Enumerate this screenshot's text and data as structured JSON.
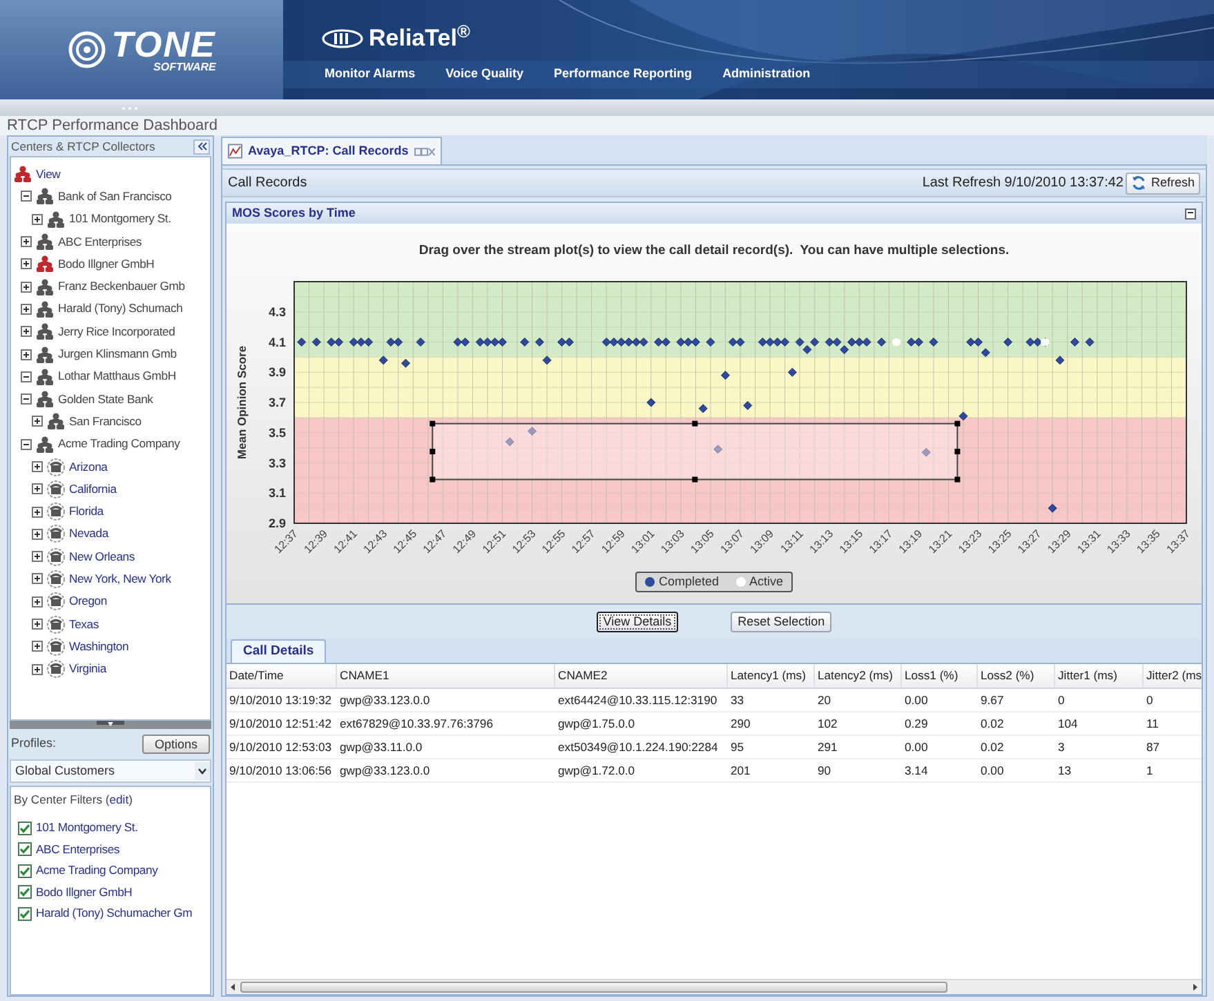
{
  "header": {
    "logo": {
      "name": "TONE",
      "tagline": "SOFTWARE"
    },
    "product": "ReliaTel$^{®}$",
    "nav": [
      {
        "label": "Monitor Alarms"
      },
      {
        "label": "Voice Quality"
      },
      {
        "label": "Performance Reporting"
      },
      {
        "label": "Administration"
      }
    ]
  },
  "page_title": "RTCP Performance Dashboard",
  "sidebar": {
    "title": "Centers & RTCP Collectors",
    "tree": [
      {
        "label": "View",
        "kind": "root",
        "alarm": true,
        "children": [
          {
            "label": "Bank of San Francisco",
            "kind": "center",
            "alarm": false,
            "expanded": true,
            "children": [
              {
                "label": "101 Montgomery St.",
                "kind": "center",
                "alarm": false,
                "expanded": false
              }
            ]
          },
          {
            "label": "ABC Enterprises",
            "kind": "center",
            "alarm": false,
            "expanded": false
          },
          {
            "label": "Bodo Illgner GmbH",
            "kind": "center",
            "alarm": true,
            "expanded": false
          },
          {
            "label": "Franz Beckenbauer Gmb",
            "kind": "center",
            "alarm": false,
            "expanded": false
          },
          {
            "label": "Harald (Tony) Schumach",
            "kind": "center",
            "alarm": false,
            "expanded": false
          },
          {
            "label": "Jerry Rice Incorporated",
            "kind": "center",
            "alarm": false,
            "expanded": false
          },
          {
            "label": "Jurgen Klinsmann Gmb",
            "kind": "center",
            "alarm": false,
            "expanded": false
          },
          {
            "label": "Lothar Matthaus GmbH",
            "kind": "center",
            "alarm": false,
            "expanded": true
          },
          {
            "label": "Golden State Bank",
            "kind": "center",
            "alarm": false,
            "expanded": true,
            "children": [
              {
                "label": "San Francisco",
                "kind": "center",
                "alarm": false,
                "expanded": false
              }
            ]
          },
          {
            "label": "Acme Trading Company",
            "kind": "center",
            "alarm": false,
            "expanded": true,
            "children": [
              {
                "label": "Arizona",
                "kind": "collector",
                "alarm": false,
                "expanded": false
              },
              {
                "label": "California",
                "kind": "collector",
                "alarm": false,
                "expanded": false
              },
              {
                "label": "Florida",
                "kind": "collector",
                "alarm": false,
                "expanded": false
              },
              {
                "label": "Nevada",
                "kind": "collector",
                "alarm": false,
                "expanded": false
              },
              {
                "label": "New Orleans",
                "kind": "collector",
                "alarm": false,
                "expanded": false
              },
              {
                "label": "New York, New York",
                "kind": "collector",
                "alarm": false,
                "expanded": false
              },
              {
                "label": "Oregon",
                "kind": "collector",
                "alarm": false,
                "expanded": false
              },
              {
                "label": "Texas",
                "kind": "collector",
                "alarm": false,
                "expanded": false
              },
              {
                "label": "Washington",
                "kind": "collector",
                "alarm": false,
                "expanded": false
              },
              {
                "label": "Virginia",
                "kind": "collector",
                "alarm": false,
                "expanded": false
              }
            ]
          }
        ]
      }
    ],
    "profiles_label": "Profiles:",
    "options_button": "Options",
    "profile_select": {
      "value": "Global Customers"
    },
    "filters_prefix": "By Center Filters (",
    "filters_link": "edit",
    "filters_suffix": ")",
    "filters": [
      {
        "label": "101 Montgomery St.",
        "checked": true
      },
      {
        "label": "ABC Enterprises",
        "checked": true
      },
      {
        "label": "Acme Trading Company",
        "checked": true
      },
      {
        "label": "Bodo Illgner GmbH",
        "checked": true
      },
      {
        "label": "Harald (Tony) Schumacher Gm",
        "checked": true
      }
    ]
  },
  "tab": {
    "label": "Avaya_RTCP: Call Records",
    "selected": true
  },
  "records": {
    "title": "Call Records",
    "last_refresh": "Last Refresh 9/10/2010 13:37:42",
    "refresh_button": "Refresh"
  },
  "mos": {
    "title": "MOS Scores by Time",
    "instruction": "Drag over the stream plot(s) to view the call detail record(s).  You can have multiple selections.",
    "chart_data": {
      "type": "scatter",
      "ylabel": "Mean Opinion Score",
      "ylim": [
        2.9,
        4.5
      ],
      "grid": true,
      "yticks": [
        2.9,
        3.1,
        3.3,
        3.5,
        3.7,
        3.9,
        4.1,
        4.3
      ],
      "series": [
        {
          "name": "Completed",
          "color": "#2f4a9c",
          "values": [
            null,
            4.1,
            null,
            4.1,
            null,
            4.1,
            4.1,
            null,
            4.1,
            4.1,
            4.1,
            null,
            3.98,
            4.1,
            4.1,
            3.96,
            null,
            4.1,
            null,
            null,
            null,
            null,
            4.1,
            4.1,
            null,
            4.1,
            4.1,
            4.1,
            4.1,
            3.44,
            null,
            4.1,
            3.51,
            4.1,
            3.98,
            null,
            4.1,
            4.1,
            null,
            null,
            null,
            null,
            4.1,
            4.1,
            4.1,
            4.1,
            4.1,
            4.1,
            3.7,
            4.1,
            4.1,
            null,
            4.1,
            4.1,
            4.1,
            3.66,
            4.1,
            3.39,
            3.88,
            4.1,
            4.1,
            3.68,
            null,
            4.1,
            4.1,
            4.1,
            4.1,
            3.9,
            4.1,
            4.05,
            4.1,
            null,
            4.1,
            4.1,
            4.05,
            4.1,
            4.1,
            4.1,
            null,
            4.1,
            null,
            null,
            null,
            4.1,
            4.1,
            3.37,
            4.1,
            null,
            null,
            null,
            3.61,
            4.1,
            4.1,
            4.03,
            null,
            null,
            4.1,
            null,
            null,
            4.1,
            4.1,
            4.1,
            3.0,
            3.98,
            null,
            4.1,
            null,
            4.1,
            null,
            null,
            null,
            null,
            null,
            null,
            null,
            null,
            null,
            null,
            null,
            null,
            null
          ]
        },
        {
          "name": "Active",
          "color": "#ffffff",
          "values": [
            null,
            null,
            null,
            null,
            null,
            null,
            null,
            null,
            null,
            null,
            null,
            null,
            null,
            null,
            null,
            null,
            null,
            null,
            null,
            null,
            null,
            null,
            null,
            null,
            null,
            null,
            null,
            null,
            null,
            null,
            null,
            null,
            null,
            null,
            null,
            null,
            null,
            null,
            null,
            null,
            null,
            null,
            null,
            null,
            null,
            null,
            null,
            null,
            null,
            null,
            null,
            null,
            null,
            null,
            null,
            null,
            null,
            null,
            null,
            null,
            null,
            null,
            null,
            null,
            null,
            null,
            null,
            null,
            null,
            null,
            null,
            null,
            null,
            null,
            null,
            null,
            null,
            null,
            null,
            null,
            null,
            4.1,
            null,
            null,
            null,
            null,
            null,
            null,
            null,
            null,
            null,
            null,
            null,
            null,
            null,
            null,
            null,
            null,
            null,
            null,
            null,
            4.1,
            null,
            null,
            null,
            null,
            null,
            null,
            null,
            null,
            null,
            null,
            null,
            null,
            null,
            null,
            null,
            null,
            null,
            null,
            null
          ]
        }
      ],
      "categories": [
        "12:37",
        null,
        null,
        null,
        "12:39",
        null,
        null,
        null,
        "12:41",
        null,
        null,
        null,
        "12:43",
        null,
        null,
        null,
        "12:45",
        null,
        null,
        null,
        "12:47",
        null,
        null,
        null,
        "12:49",
        null,
        null,
        null,
        "12:51",
        null,
        null,
        null,
        "12:53",
        null,
        null,
        null,
        "12:55",
        null,
        null,
        null,
        "12:57",
        null,
        null,
        null,
        "12:59",
        null,
        null,
        null,
        "13:01",
        null,
        null,
        null,
        "13:03",
        null,
        null,
        null,
        "13:05",
        null,
        null,
        null,
        "13:07",
        null,
        null,
        null,
        "13:09",
        null,
        null,
        null,
        "13:11",
        null,
        null,
        null,
        "13:13",
        null,
        null,
        null,
        "13:15",
        null,
        null,
        null,
        "13:17",
        null,
        null,
        null,
        "13:19",
        null,
        null,
        null,
        "13:21",
        null,
        null,
        null,
        "13:23",
        null,
        null,
        null,
        "13:25",
        null,
        null,
        null,
        "13:27",
        null,
        null,
        null,
        "13:29",
        null,
        null,
        null,
        "13:31",
        null,
        null,
        null,
        "13:33",
        null,
        null,
        null,
        "13:35",
        null,
        null,
        null,
        "13:37"
      ]
    },
    "selection_active": true
  },
  "actions": [
    {
      "label": "View Details",
      "focused": true
    },
    {
      "label": "Reset Selection",
      "focused": false
    }
  ],
  "details_tab": {
    "label": "Call Details",
    "selected": true
  },
  "table": {
    "columns": [
      "Date/Time",
      "CNAME1",
      "CNAME2",
      "Latency1 (ms)",
      "Latency2 (ms)",
      "Loss1 (%)",
      "Loss2 (%)",
      "Jitter1 (ms)",
      "Jitter2 (ms"
    ],
    "rows": [
      [
        "9/10/2010 13:19:32",
        "gwp@33.123.0.0",
        "ext64424@10.33.115.12:3190",
        "33",
        "20",
        "0.00",
        "9.67",
        "0",
        "0"
      ],
      [
        "9/10/2010 12:51:42",
        "ext67829@10.33.97.76:3796",
        "gwp@1.75.0.0",
        "290",
        "102",
        "0.29",
        "0.02",
        "104",
        "11"
      ],
      [
        "9/10/2010 12:53:03",
        "gwp@33.11.0.0",
        "ext50349@10.1.224.190:2284",
        "95",
        "291",
        "0.00",
        "0.02",
        "3",
        "87"
      ],
      [
        "9/10/2010 13:06:56",
        "gwp@33.123.0.0",
        "gwp@1.72.0.0",
        "201",
        "90",
        "3.14",
        "0.00",
        "13",
        "1"
      ]
    ]
  }
}
